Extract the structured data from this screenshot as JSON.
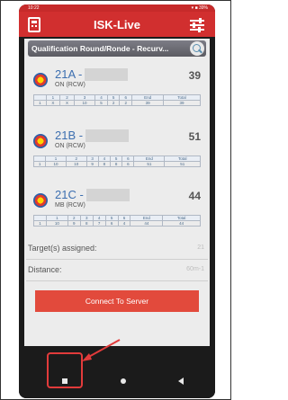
{
  "statusbar": {
    "time": "10:22",
    "battery": "▾ ■ 39%"
  },
  "appbar": {
    "title": "ISK-Live"
  },
  "round": {
    "label": "Qualification Round/Ronde - Recurv..."
  },
  "archers": [
    {
      "name": "21A -",
      "sub": "ON (RCW)",
      "total": "39",
      "header": [
        "",
        "1",
        "2",
        "3",
        "4",
        "5",
        "6",
        "End",
        "Total"
      ],
      "row": [
        "1",
        "X",
        "X",
        "10",
        "5",
        "2",
        "2",
        "39",
        "39"
      ]
    },
    {
      "name": "21B -",
      "sub": "ON (RCW)",
      "total": "51",
      "header": [
        "",
        "1",
        "2",
        "3",
        "4",
        "5",
        "6",
        "End",
        "Total"
      ],
      "row": [
        "1",
        "10",
        "10",
        "9",
        "8",
        "8",
        "6",
        "51",
        "51"
      ]
    },
    {
      "name": "21C -",
      "sub": "MB (RCW)",
      "total": "44",
      "header": [
        "",
        "1",
        "2",
        "3",
        "4",
        "5",
        "6",
        "End",
        "Total"
      ],
      "row": [
        "1",
        "10",
        "9",
        "8",
        "7",
        "6",
        "4",
        "44",
        "44"
      ]
    }
  ],
  "info": {
    "targets_label": "Target(s) assigned:",
    "targets_value": "21",
    "distance_label": "Distance:",
    "distance_value": "60m-1"
  },
  "connect_label": "Connect To Server",
  "colors": {
    "appbar": "#d12f2f",
    "button": "#e24a3c",
    "highlight": "#e23b3b"
  },
  "icons": {
    "appbar_left": "scoreboard-icon",
    "appbar_right": "tune-icon",
    "round": "search-icon",
    "archer": "target-icon"
  }
}
